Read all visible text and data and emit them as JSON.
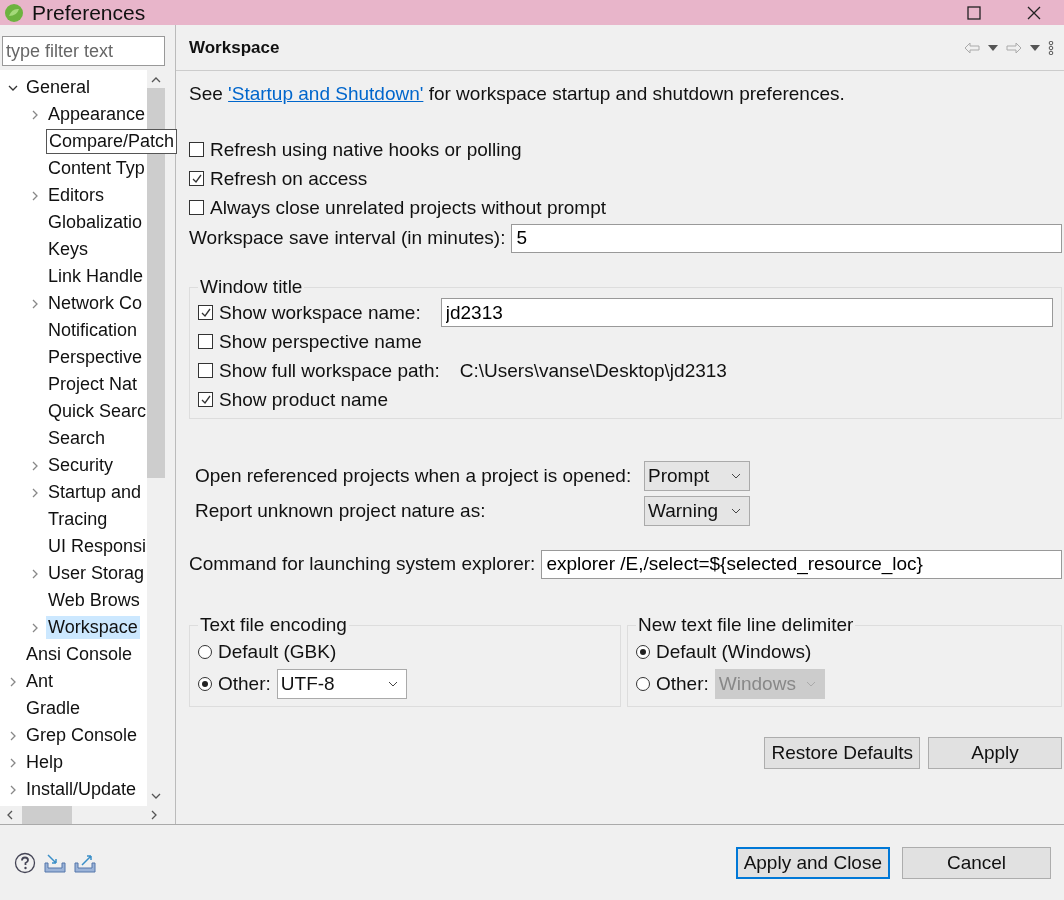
{
  "window": {
    "title": "Preferences"
  },
  "filter": {
    "placeholder": "type filter text"
  },
  "tree": [
    {
      "label": "General",
      "expanded": true,
      "selected": false,
      "children": [
        {
          "label": "Appearance",
          "expanded": false,
          "selected": false
        },
        {
          "label": "Compare/Patch",
          "selected": false,
          "tooltip": true
        },
        {
          "label": "Content Typ",
          "selected": false
        },
        {
          "label": "Editors",
          "expanded": false,
          "selected": false
        },
        {
          "label": "Globalizatio",
          "selected": false
        },
        {
          "label": "Keys",
          "selected": false
        },
        {
          "label": "Link Handle",
          "selected": false
        },
        {
          "label": "Network Co",
          "expanded": false,
          "selected": false
        },
        {
          "label": "Notification",
          "selected": false
        },
        {
          "label": "Perspective",
          "selected": false
        },
        {
          "label": "Project Nat",
          "selected": false
        },
        {
          "label": "Quick Searc",
          "selected": false
        },
        {
          "label": "Search",
          "selected": false
        },
        {
          "label": "Security",
          "expanded": false,
          "selected": false
        },
        {
          "label": "Startup and",
          "expanded": false,
          "selected": false
        },
        {
          "label": "Tracing",
          "selected": false
        },
        {
          "label": "UI Responsi",
          "selected": false
        },
        {
          "label": "User Storag",
          "expanded": false,
          "selected": false
        },
        {
          "label": "Web Brows",
          "selected": false
        },
        {
          "label": "Workspace",
          "expanded": false,
          "selected": true
        }
      ]
    },
    {
      "label": "Ansi Console",
      "selected": false
    },
    {
      "label": "Ant",
      "expanded": false,
      "selected": false
    },
    {
      "label": "Gradle",
      "selected": false
    },
    {
      "label": "Grep Console",
      "expanded": false,
      "selected": false
    },
    {
      "label": "Help",
      "expanded": false,
      "selected": false
    },
    {
      "label": "Install/Update",
      "expanded": false,
      "selected": false
    }
  ],
  "page": {
    "title": "Workspace",
    "intro": {
      "before": "See",
      "link": "'Startup and Shutdown'",
      "after": "for workspace startup and shutdown preferences."
    },
    "options": [
      {
        "label": "Refresh using native hooks or polling",
        "checked": false
      },
      {
        "label": "Refresh on access",
        "checked": true
      },
      {
        "label": "Always close unrelated projects without prompt",
        "checked": false
      }
    ],
    "save_interval": {
      "label": "Workspace save interval (in minutes):",
      "value": "5"
    },
    "window_title": {
      "title": "Window title",
      "items": [
        {
          "kind": "field",
          "label": "Show workspace name:",
          "checked": true,
          "value": "jd2313"
        },
        {
          "kind": "plain",
          "label": "Show perspective name",
          "checked": false
        },
        {
          "kind": "text",
          "label": "Show full workspace path:",
          "checked": false,
          "text": "C:\\Users\\vanse\\Desktop\\jd2313"
        },
        {
          "kind": "plain",
          "label": "Show product name",
          "checked": true
        }
      ]
    },
    "dropdowns": [
      {
        "label": "Open referenced projects when a project is opened:",
        "value": "Prompt"
      },
      {
        "label": "Report unknown project nature as:",
        "value": "Warning"
      }
    ],
    "explorer": {
      "label": "Command for launching system explorer:",
      "value": "explorer /E,/select=${selected_resource_loc}"
    },
    "groups": [
      {
        "title": "Text file encoding",
        "options": [
          {
            "label": "Default (GBK)",
            "selected": false
          },
          {
            "label": "Other:",
            "selected": true,
            "value": "UTF-8",
            "disabled": false
          }
        ]
      },
      {
        "title": "New text file line delimiter",
        "options": [
          {
            "label": "Default (Windows)",
            "selected": true
          },
          {
            "label": "Other:",
            "selected": false,
            "value": "Windows",
            "disabled": true
          }
        ]
      }
    ],
    "buttons": [
      "Restore Defaults",
      "Apply"
    ]
  },
  "footer": {
    "buttons": [
      {
        "label": "Apply and Close",
        "default": true
      },
      {
        "label": "Cancel",
        "default": false
      }
    ]
  }
}
